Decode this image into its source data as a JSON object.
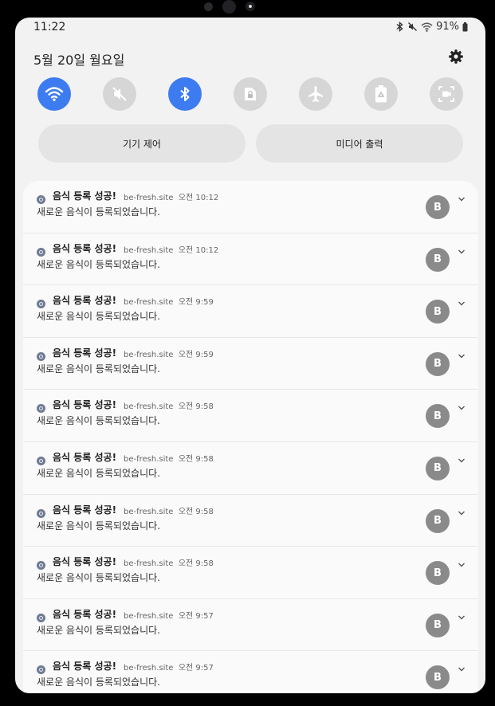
{
  "status_bar": {
    "time": "11:22",
    "battery": "91%"
  },
  "header": {
    "date": "5월 20일 월요일"
  },
  "quick_settings": [
    {
      "icon": "wifi-icon",
      "state": "on"
    },
    {
      "icon": "mute-icon",
      "state": "off"
    },
    {
      "icon": "bluetooth-icon",
      "state": "on"
    },
    {
      "icon": "secure-folder-icon",
      "state": "off"
    },
    {
      "icon": "airplane-icon",
      "state": "off"
    },
    {
      "icon": "power-saving-icon",
      "state": "off"
    },
    {
      "icon": "screen-recorder-icon",
      "state": "off"
    }
  ],
  "controls": {
    "device_control": "기기 제어",
    "media_output": "미디어 출력"
  },
  "notifications": [
    {
      "title": "음식 등록 성공!",
      "site": "be-fresh.site",
      "time": "오전 10:12",
      "body": "새로운 음식이 등록되었습니다.",
      "avatar": "B"
    },
    {
      "title": "음식 등록 성공!",
      "site": "be-fresh.site",
      "time": "오전 10:12",
      "body": "새로운 음식이 등록되었습니다.",
      "avatar": "B"
    },
    {
      "title": "음식 등록 성공!",
      "site": "be-fresh.site",
      "time": "오전 9:59",
      "body": "새로운 음식이 등록되었습니다.",
      "avatar": "B"
    },
    {
      "title": "음식 등록 성공!",
      "site": "be-fresh.site",
      "time": "오전 9:59",
      "body": "새로운 음식이 등록되었습니다.",
      "avatar": "B"
    },
    {
      "title": "음식 등록 성공!",
      "site": "be-fresh.site",
      "time": "오전 9:58",
      "body": "새로운 음식이 등록되었습니다.",
      "avatar": "B"
    },
    {
      "title": "음식 등록 성공!",
      "site": "be-fresh.site",
      "time": "오전 9:58",
      "body": "새로운 음식이 등록되었습니다.",
      "avatar": "B"
    },
    {
      "title": "음식 등록 성공!",
      "site": "be-fresh.site",
      "time": "오전 9:58",
      "body": "새로운 음식이 등록되었습니다.",
      "avatar": "B"
    },
    {
      "title": "음식 등록 성공!",
      "site": "be-fresh.site",
      "time": "오전 9:58",
      "body": "새로운 음식이 등록되었습니다.",
      "avatar": "B"
    },
    {
      "title": "음식 등록 성공!",
      "site": "be-fresh.site",
      "time": "오전 9:57",
      "body": "새로운 음식이 등록되었습니다.",
      "avatar": "B"
    },
    {
      "title": "음식 등록 성공!",
      "site": "be-fresh.site",
      "time": "오전 9:57",
      "body": "새로운 음식이 등록되었습니다.",
      "avatar": "B"
    }
  ],
  "colors": {
    "accent": "#3d7cf0",
    "tile_off": "#d6d6d6",
    "panel_bg": "#f2f2f2",
    "avatar": "#8a8a8a"
  }
}
